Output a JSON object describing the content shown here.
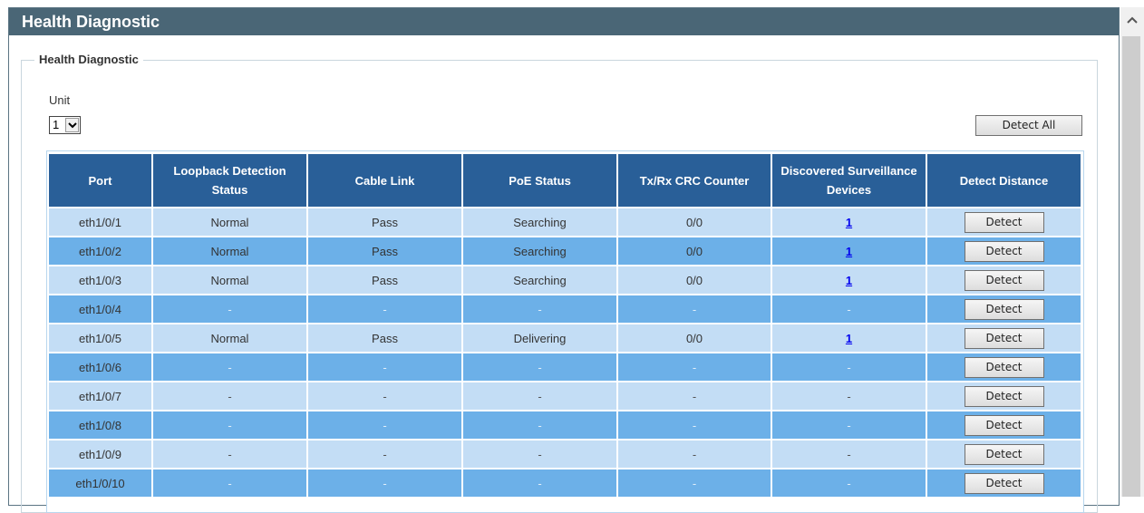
{
  "window": {
    "title": "Health Diagnostic"
  },
  "section": {
    "legend": "Health Diagnostic"
  },
  "unit": {
    "label": "Unit",
    "selected": "1"
  },
  "toolbar": {
    "detect_all_label": "Detect All"
  },
  "table": {
    "headers": {
      "port": "Port",
      "loopback_line1": "Loopback Detection",
      "loopback_line2": "Status",
      "cable_link": "Cable Link",
      "poe_status": "PoE Status",
      "crc": "Tx/Rx CRC Counter",
      "surv_line1": "Discovered Surveillance",
      "surv_line2": "Devices",
      "detect_distance": "Detect Distance"
    },
    "rows": [
      {
        "port": "eth1/0/1",
        "loopback": "Normal",
        "cable": "Pass",
        "poe": "Searching",
        "crc": "0/0",
        "devices": "1",
        "action": "Detect"
      },
      {
        "port": "eth1/0/2",
        "loopback": "Normal",
        "cable": "Pass",
        "poe": "Searching",
        "crc": "0/0",
        "devices": "1",
        "action": "Detect"
      },
      {
        "port": "eth1/0/3",
        "loopback": "Normal",
        "cable": "Pass",
        "poe": "Searching",
        "crc": "0/0",
        "devices": "1",
        "action": "Detect"
      },
      {
        "port": "eth1/0/4",
        "loopback": "-",
        "cable": "-",
        "poe": "-",
        "crc": "-",
        "devices": "-",
        "action": "Detect"
      },
      {
        "port": "eth1/0/5",
        "loopback": "Normal",
        "cable": "Pass",
        "poe": "Delivering",
        "crc": "0/0",
        "devices": "1",
        "action": "Detect"
      },
      {
        "port": "eth1/0/6",
        "loopback": "-",
        "cable": "-",
        "poe": "-",
        "crc": "-",
        "devices": "-",
        "action": "Detect"
      },
      {
        "port": "eth1/0/7",
        "loopback": "-",
        "cable": "-",
        "poe": "-",
        "crc": "-",
        "devices": "-",
        "action": "Detect"
      },
      {
        "port": "eth1/0/8",
        "loopback": "-",
        "cable": "-",
        "poe": "-",
        "crc": "-",
        "devices": "-",
        "action": "Detect"
      },
      {
        "port": "eth1/0/9",
        "loopback": "-",
        "cable": "-",
        "poe": "-",
        "crc": "-",
        "devices": "-",
        "action": "Detect"
      },
      {
        "port": "eth1/0/10",
        "loopback": "-",
        "cable": "-",
        "poe": "-",
        "crc": "-",
        "devices": "-",
        "action": "Detect"
      }
    ]
  },
  "colors": {
    "title_bar": "#4a6676",
    "header_bg": "#295f98",
    "row_light": "#c3ddf5",
    "row_dark": "#6cb0e8",
    "link": "#0000ee"
  },
  "icons": {
    "select_arrow": "chevron-down-icon",
    "scroll_up": "chevron-up-icon"
  }
}
